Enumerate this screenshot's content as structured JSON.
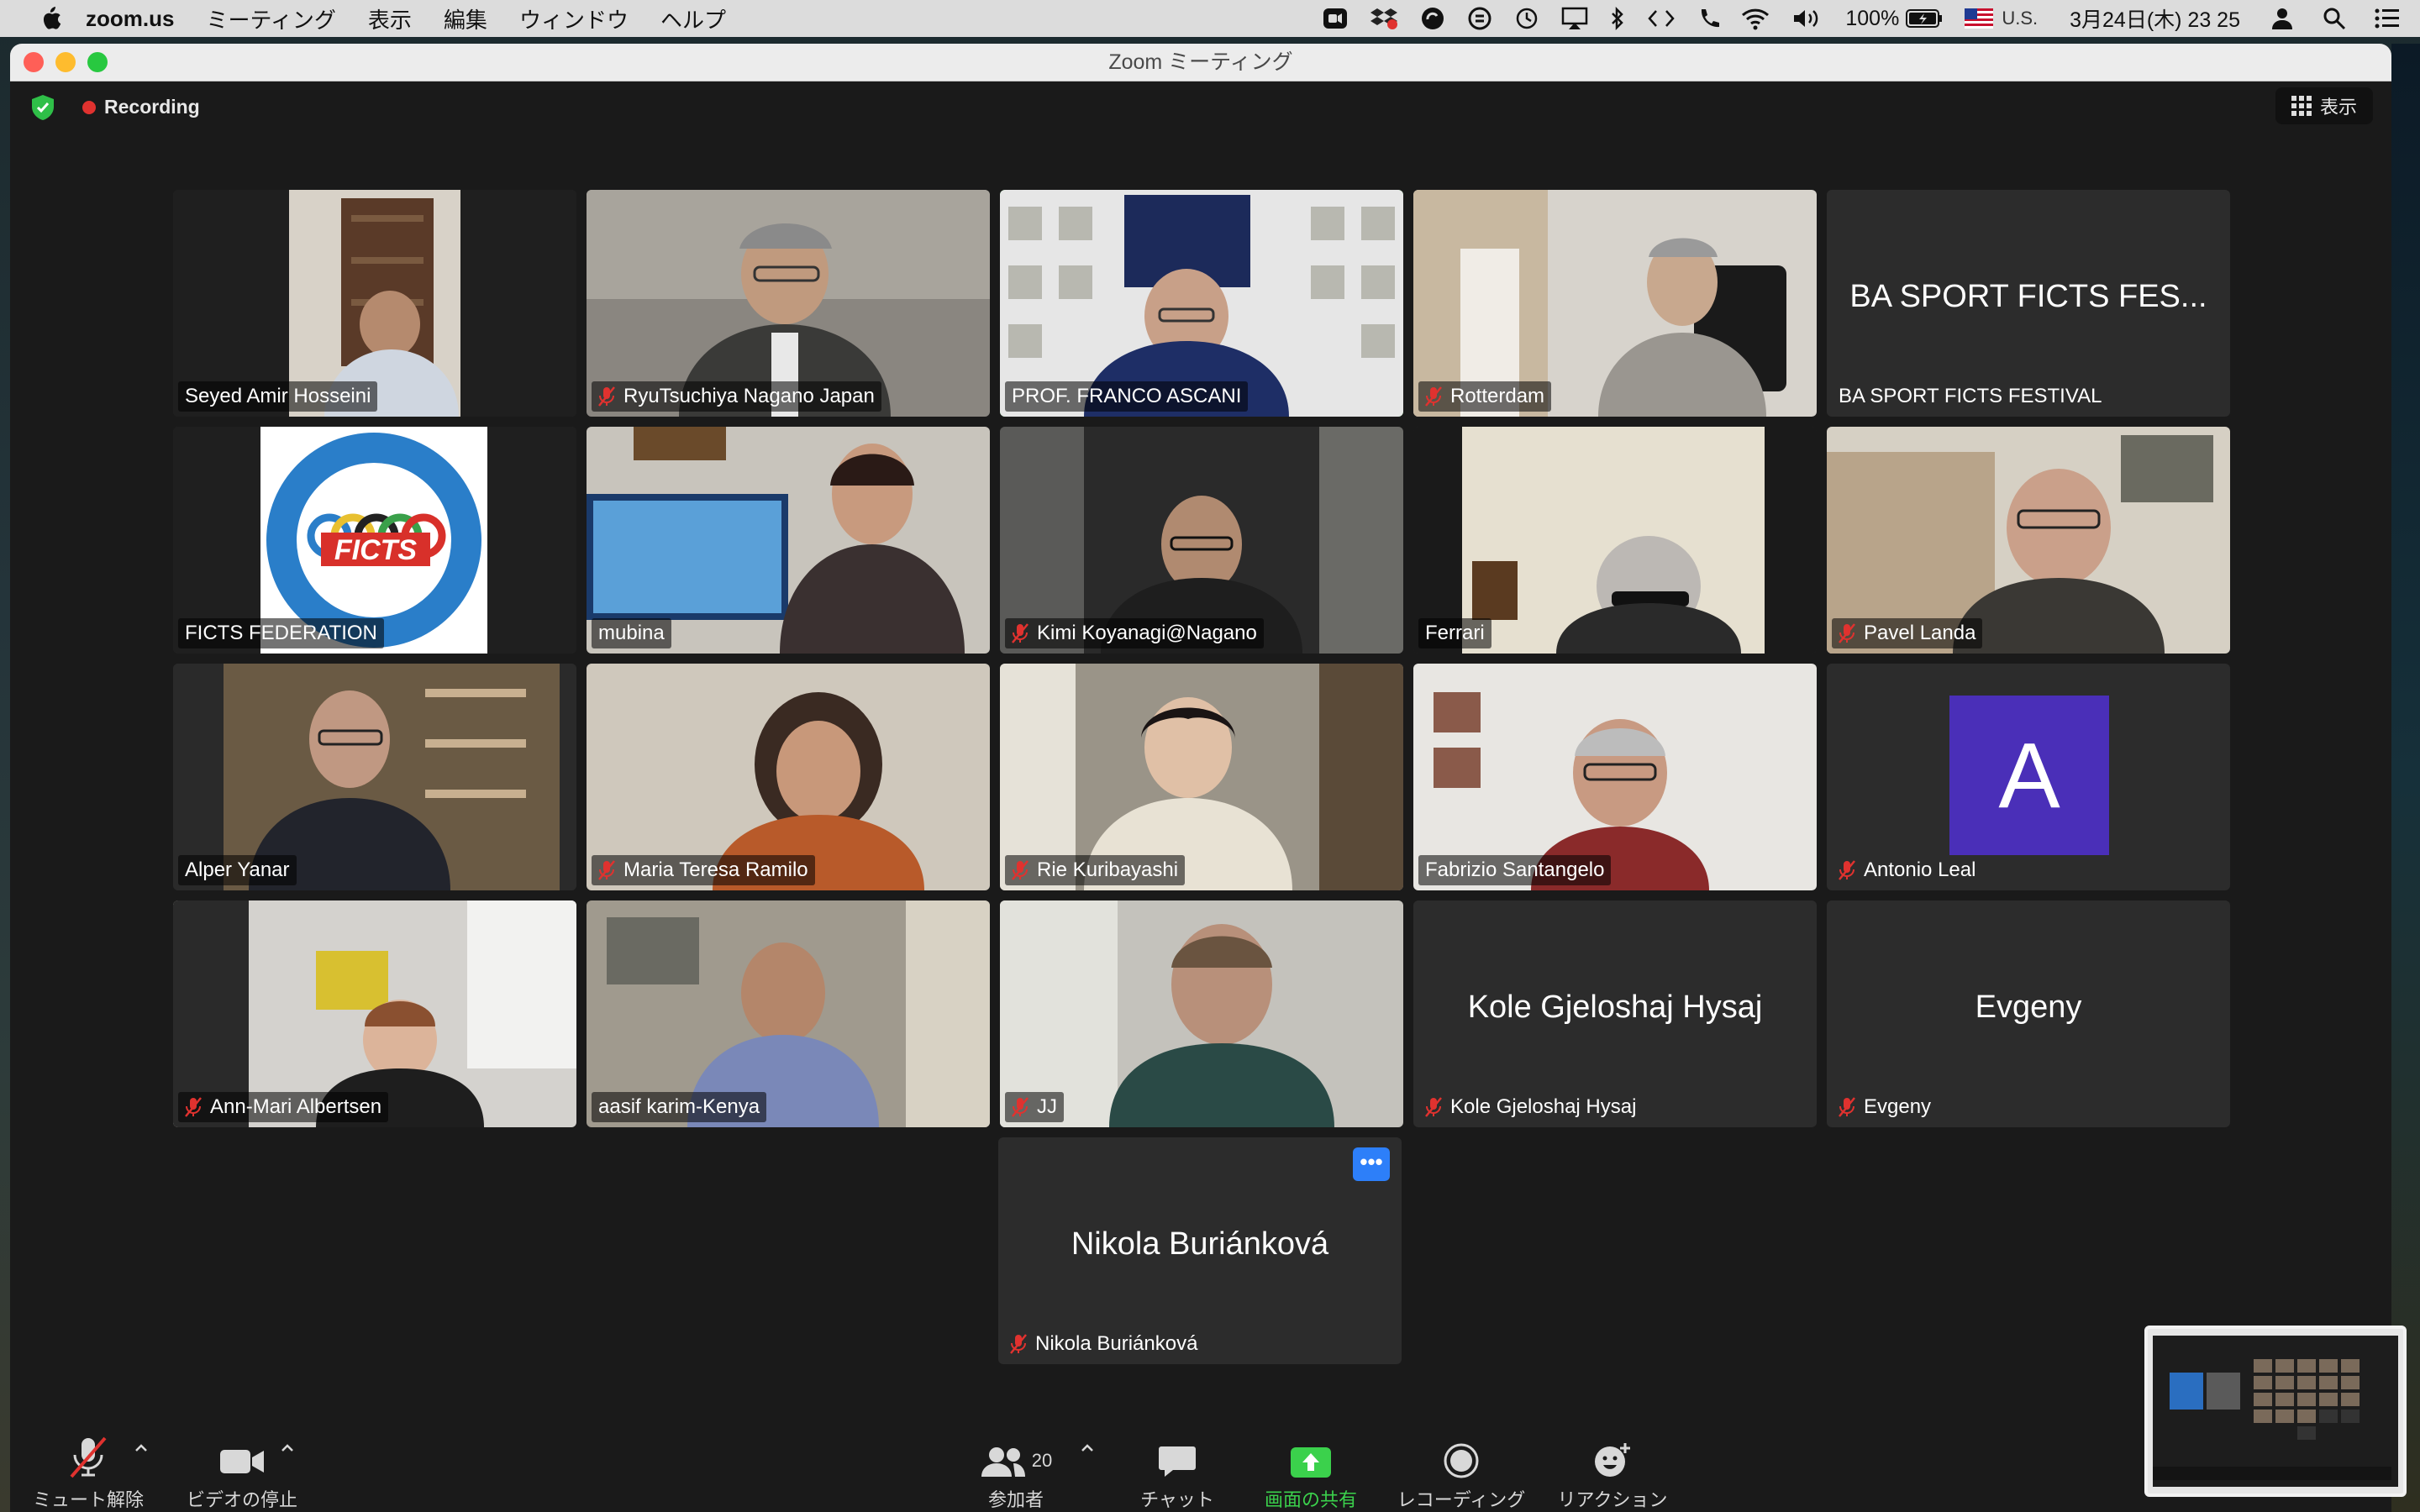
{
  "menubar": {
    "app_name": "zoom.us",
    "items": [
      "ミーティング",
      "表示",
      "編集",
      "ウィンドウ",
      "ヘルプ"
    ],
    "battery": "100%",
    "input_source": "U.S.",
    "datetime": "3月24日(木)  23 25"
  },
  "window": {
    "title": "Zoom ミーティング",
    "recording_label": "Recording",
    "view_button_label": "表示"
  },
  "participants": [
    {
      "name": "Seyed Amir Hosseini",
      "muted": false,
      "video": true
    },
    {
      "name": "RyuTsuchiya Nagano Japan",
      "muted": true,
      "video": true
    },
    {
      "name": "PROF. FRANCO ASCANI",
      "muted": false,
      "video": true,
      "active_speaker": true
    },
    {
      "name": "Rotterdam",
      "muted": true,
      "video": true
    },
    {
      "name": "BA SPORT FICTS FESTIVAL",
      "display_title": "BA SPORT FICTS FES...",
      "muted": false,
      "video": false
    },
    {
      "name": "FICTS FEDERATION",
      "muted": false,
      "video": true,
      "logo_text": "FICTS",
      "logo_ring_text": "FEDERATION INTERNATIONALE CINEMA TELEVISION SPORTIFS"
    },
    {
      "name": "mubina",
      "muted": false,
      "video": true
    },
    {
      "name": "Kimi Koyanagi@Nagano",
      "muted": true,
      "video": true
    },
    {
      "name": "Ferrari",
      "muted": false,
      "video": true
    },
    {
      "name": "Pavel Landa",
      "muted": true,
      "video": true
    },
    {
      "name": "Alper Yanar",
      "muted": false,
      "video": true
    },
    {
      "name": "Maria Teresa Ramilo",
      "muted": true,
      "video": true
    },
    {
      "name": "Rie Kuribayashi",
      "muted": true,
      "video": true
    },
    {
      "name": "Fabrizio Santangelo",
      "muted": false,
      "video": true
    },
    {
      "name": "Antonio Leal",
      "muted": true,
      "video": false,
      "avatar_letter": "A"
    },
    {
      "name": "Ann-Mari Albertsen",
      "muted": true,
      "video": true
    },
    {
      "name": "aasif karim-Kenya",
      "muted": false,
      "video": true
    },
    {
      "name": "JJ",
      "muted": true,
      "video": true
    },
    {
      "name": "Kole Gjeloshaj Hysaj",
      "display_title": "Kole Gjeloshaj Hysaj",
      "muted": true,
      "video": false
    },
    {
      "name": "Evgeny",
      "display_title": "Evgeny",
      "muted": true,
      "video": false
    },
    {
      "name": "Nikola Buriánková",
      "display_title": "Nikola Buriánková",
      "muted": true,
      "video": false,
      "more_button": "•••"
    }
  ],
  "toolbar": {
    "unmute_label": "ミュート解除",
    "stop_video_label": "ビデオの停止",
    "participants_label": "参加者",
    "participants_count": "20",
    "chat_label": "チャット",
    "share_label": "画面の共有",
    "record_label": "レコーディング",
    "reactions_label": "リアクション"
  },
  "colors": {
    "active_speaker_border": "#3ad34a",
    "share_green": "#3bd14c",
    "mute_red": "#e0322f",
    "avatar_purple": "#4a2fb8",
    "more_button_blue": "#2d7ff9"
  }
}
